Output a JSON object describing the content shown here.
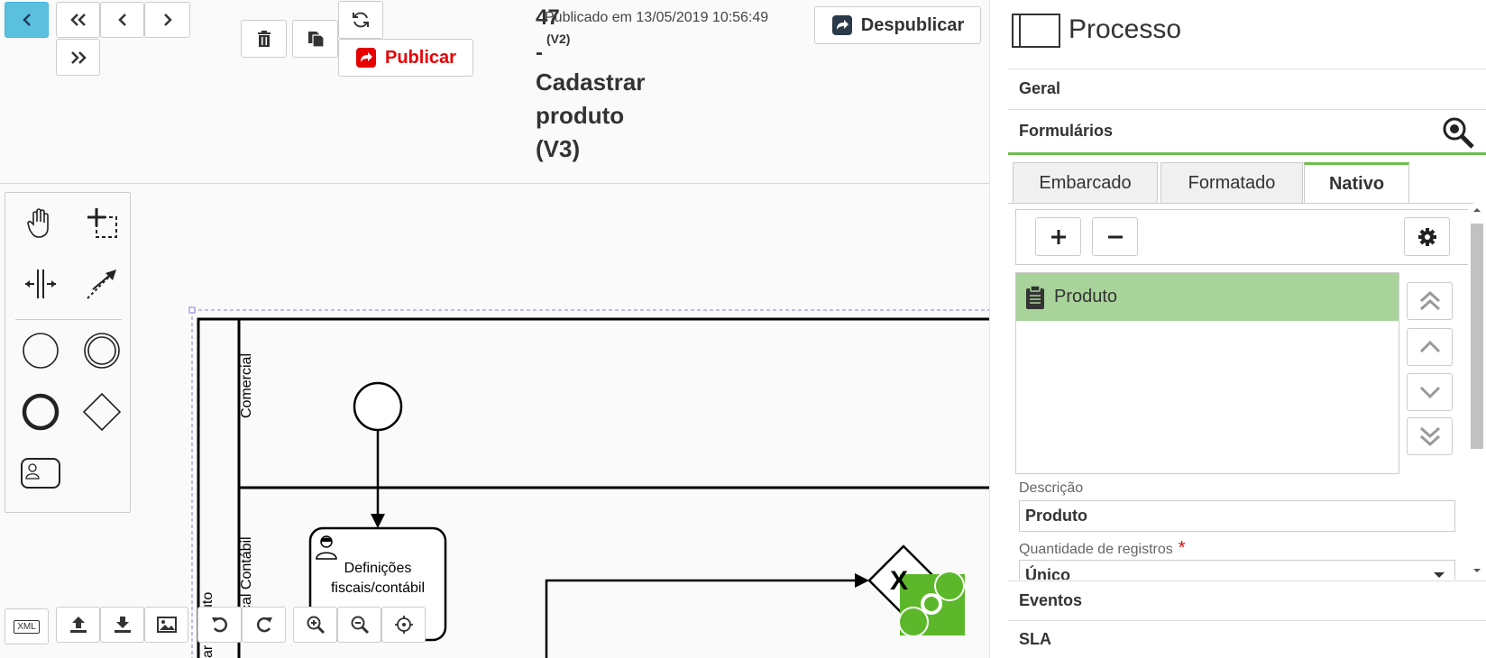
{
  "header": {
    "process_number": "47",
    "process_dash": "-",
    "published_info": "Publicado em 13/05/2019 10:56:49",
    "published_version": "(V2)",
    "process_name": "Cadastrar produto (V3)",
    "publish_label": "Publicar",
    "unpublish_label": "Despublicar"
  },
  "diagram": {
    "lane_1": "Comercial",
    "lane_2": "cal Contábil",
    "pool": "uto",
    "pool_2": "ar",
    "task_label_1": "Definições",
    "task_label_2": "fiscais/contábil",
    "gateway_symbol": "X"
  },
  "bottom_toolbar": {
    "xml_label": "XML"
  },
  "panel": {
    "title": "Processo",
    "sections": {
      "geral": "Geral",
      "formularios": "Formulários",
      "eventos": "Eventos",
      "sla": "SLA"
    },
    "tabs": [
      "Embarcado",
      "Formatado",
      "Nativo"
    ],
    "active_tab": "Nativo",
    "form_list": [
      {
        "name": "Produto",
        "selected": true
      }
    ],
    "descricao_label": "Descrição",
    "descricao_value": "Produto",
    "quantidade_label": "Quantidade de registros",
    "required_mark": "*",
    "quantidade_value": "Único"
  },
  "colors": {
    "accent_blue": "#5bc0de",
    "publish_red": "#e60000",
    "green_accent": "#6ebf4e",
    "selected_row": "#a8d39a",
    "gear_green": "#5cb82a"
  }
}
